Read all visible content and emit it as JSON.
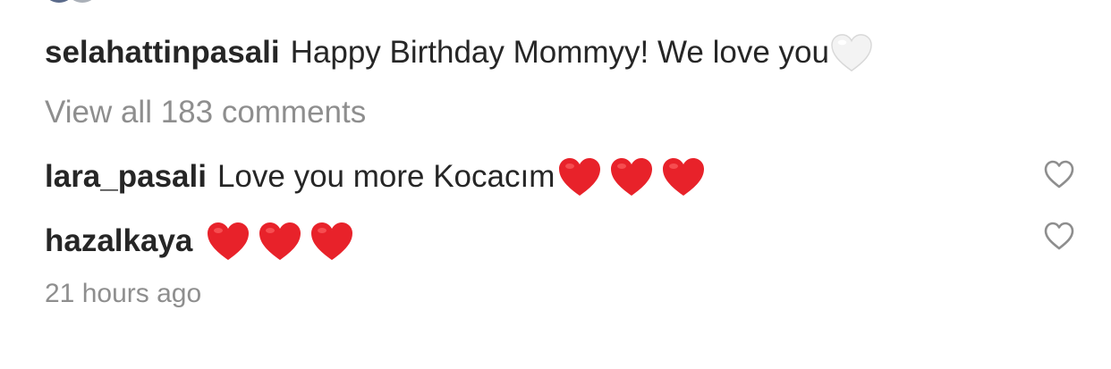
{
  "caption": {
    "username": "selahattinpasali",
    "text": "Happy Birthday Mommyy! We love you",
    "emoji": "white-heart"
  },
  "view_all": "View all 183 comments",
  "comments": [
    {
      "username": "lara_pasali",
      "text": "Love you more Kocacım",
      "emoji": [
        "red-heart",
        "red-heart",
        "red-heart"
      ]
    },
    {
      "username": "hazalkaya",
      "text": "",
      "emoji": [
        "red-heart",
        "red-heart",
        "red-heart"
      ]
    }
  ],
  "timestamp": "21 hours ago",
  "icons": {
    "like": "heart-outline-icon"
  },
  "colors": {
    "text": "#262626",
    "secondary": "#8e8e8e",
    "heart_red": "#e8222a"
  }
}
